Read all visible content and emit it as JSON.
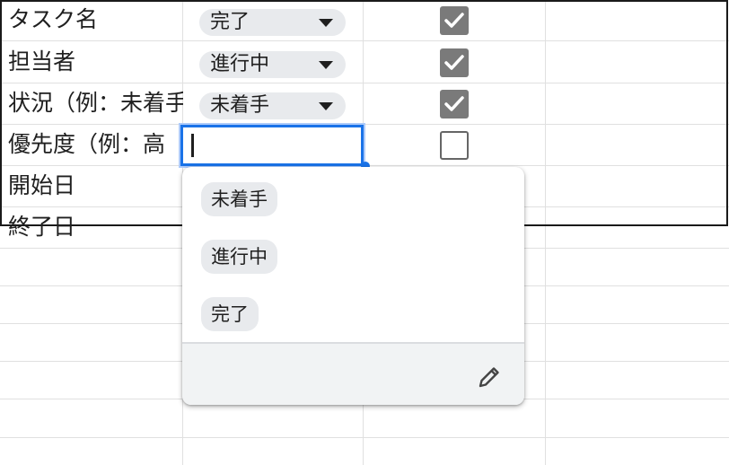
{
  "rows": [
    {
      "label": "タスク名",
      "status": "完了",
      "checked": true
    },
    {
      "label": "担当者",
      "status": "進行中",
      "checked": true
    },
    {
      "label": "状況（例：未着手",
      "status": "未着手",
      "checked": true
    },
    {
      "label": "優先度（例：高",
      "status": "",
      "checked": false
    },
    {
      "label": "開始日"
    },
    {
      "label": "終了日"
    }
  ],
  "dropdown": {
    "options": [
      "未着手",
      "進行中",
      "完了"
    ],
    "edit_icon": "pencil-icon"
  },
  "active_cell": {
    "value": ""
  },
  "colors": {
    "accent": "#1a73e8",
    "chip": "#e8eaed",
    "checkbox": "#7a7a7a"
  }
}
